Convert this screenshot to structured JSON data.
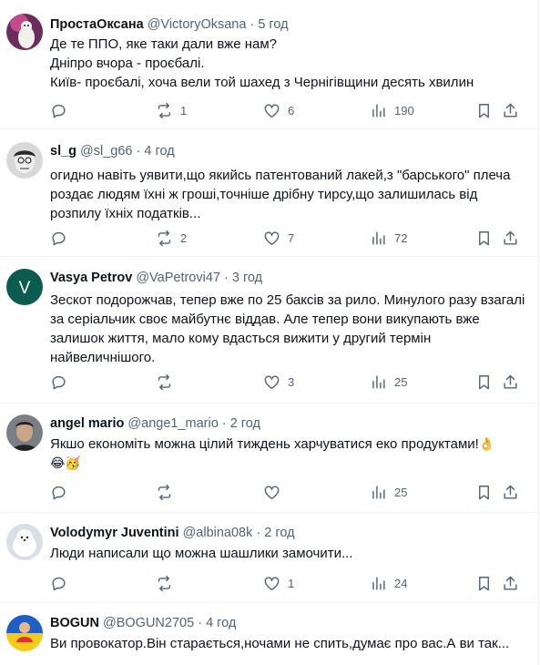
{
  "posts": [
    {
      "name": "ПростаОксана",
      "handle": "@VictoryOksana",
      "time": "5 год",
      "text": "Де те ППО, яке таки дали вже нам?\nДніпро вчора - проєбалі.\nКиїв- проєбалі, хоча вели той шахед з Чернігівщини десять хвилин",
      "replies": "",
      "reposts": "1",
      "likes": "6",
      "views": "190"
    },
    {
      "name": "sl_g",
      "handle": "@sl_g66",
      "time": "4 год",
      "text": "огидно навіть уявити,що якийсь патентований лакей,з \"барського\" плеча роздає людям їхні ж гроші,точніше дрібну тирсу,що залишилась від розпилу їхніх податків...",
      "replies": "",
      "reposts": "2",
      "likes": "7",
      "views": "72"
    },
    {
      "name": "Vasya Petrov",
      "handle": "@VaPetrovi47",
      "time": "3 год",
      "text": "Зескот подорожчав, тепер вже по 25 баксів за рило. Минулого разу взагалі за серіальчик своє майбутнє віддав. Але тепер вони викупають вже залишок життя, мало кому вдасться вижити у другий термін найвеличнішого.",
      "replies": "",
      "reposts": "",
      "likes": "3",
      "views": "25",
      "avatar_letter": "V"
    },
    {
      "name": "angel mario",
      "handle": "@ange1_mario",
      "time": "2 год",
      "text": "Якшо економіть можна цілий тиждень харчуватися еко продуктами!",
      "emoji": "👌\n😂🥳",
      "replies": "",
      "reposts": "",
      "likes": "",
      "views": "25"
    },
    {
      "name": "Volodymyr Juventini",
      "handle": "@albina08k",
      "time": "2 год",
      "text": "Люди написали що можна шашлики замочити...",
      "replies": "",
      "reposts": "",
      "likes": "1",
      "views": "24"
    },
    {
      "name": "BOGUN",
      "handle": "@BOGUN2705",
      "time": "4 год",
      "text": "Ви провокатор.Він старається,ночами не спить,думає про вас.А ви так...",
      "replies": "",
      "reposts": "",
      "likes": "",
      "views": ""
    }
  ],
  "separator": "·",
  "colors": {
    "text": "#0f1419",
    "muted": "#536471",
    "divider": "#eff3f4",
    "avatar_green": "#0b5c4e"
  },
  "icons": [
    "reply-icon",
    "repost-icon",
    "like-icon",
    "views-icon",
    "bookmark-icon",
    "share-icon"
  ]
}
